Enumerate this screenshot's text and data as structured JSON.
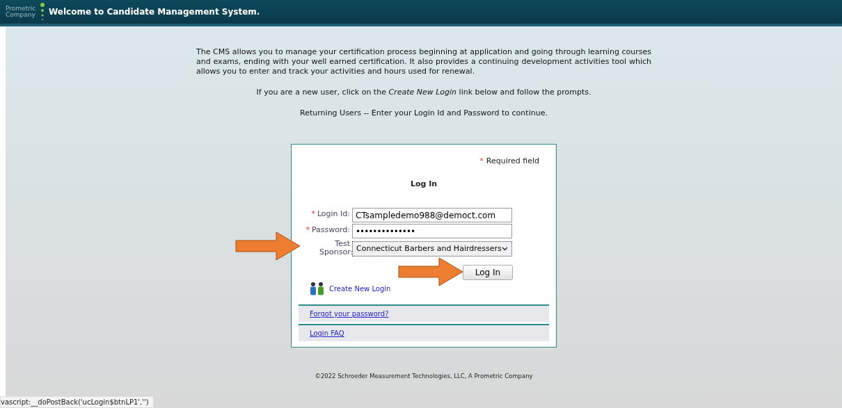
{
  "header": {
    "logo_text": "Prometric Company",
    "title": "Welcome to Candidate Management System."
  },
  "intro": {
    "paragraph": "The CMS allows you to manage your certification process beginning at application and going through learning courses and exams, ending with your well earned certification. It also provides a continuing development activities tool which allows you to enter and track your activities and hours used for renewal.",
    "new_user": "If you are a new user, click on the *Create New Login* link below and follow the prompts.",
    "returning": "Returning Users -- Enter your Login Id and Password to continue."
  },
  "login": {
    "required_note": "Required field",
    "required_mark": "*",
    "heading": "Log In",
    "fields": [
      {
        "kind": "text",
        "label": "Login Id:",
        "required": true,
        "value": "CTsampledemo988@democt.com"
      },
      {
        "kind": "password",
        "label": "Password:",
        "required": true,
        "value": "••••••••••••••"
      },
      {
        "kind": "select",
        "label": "Test Sponsor:",
        "required": false,
        "value": "Connecticut Barbers and Hairdressers"
      }
    ],
    "button": "Log In",
    "create_link": "Create New Login",
    "footer_links": [
      "Forgot your password?",
      "Login FAQ"
    ]
  },
  "copyright": "©2022 Schroeder Measurement Technologies, LLC, A Prometric Company",
  "status_bar": "vascript:__doPostBack('ucLogin$btnLP1','')"
}
